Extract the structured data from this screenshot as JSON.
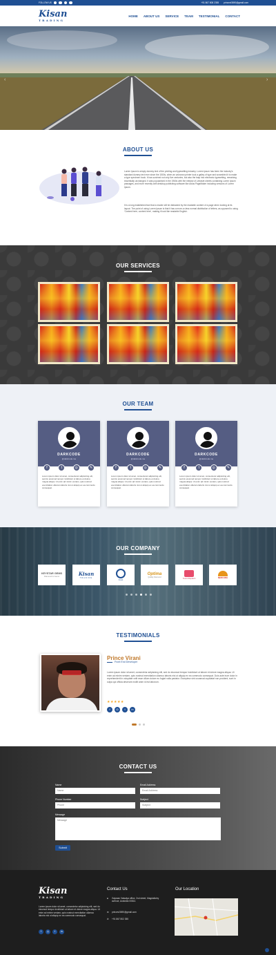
{
  "topbar": {
    "follow_label": "FOLLOW US",
    "phone": "+91 867 808 2355",
    "email": "princevi3690@gmail.com"
  },
  "brand": {
    "name": "Kisan",
    "tagline": "TRADING"
  },
  "nav": {
    "items": [
      "HOME",
      "ABOUT US",
      "SERVICE",
      "TEAM",
      "TESTIMONIAL",
      "CONTACT"
    ]
  },
  "about": {
    "title": "ABOUT US",
    "para1": "Lorem Ipsum is simply dummy text of the printing and typesetting industry. Lorem Ipsum has been the industry's standard dummy text ever since the 1500s, when an unknown printer took a galley of type and scrambled it to make a type specimen book. It has survived not only five centuries, but also the leap into electronic typesetting, remaining essentially unchanged. It was popularised in the 1960s with the release of Letraset sheets containing Lorem Ipsum passages, and more recently with desktop publishing software like Aldus PageMaker including versions of Lorem Ipsum.",
    "para2": "It is a long established fact that a reader will be distracted by the readable content of a page when looking at its layout. The point of using Lorem Ipsum is that it has a more-or-less normal distribution of letters, as opposed to using 'Content here, content here', making it look like readable English."
  },
  "services": {
    "title": "OUR SERVICES"
  },
  "team": {
    "title": "OUR TEAM",
    "members": [
      {
        "name": "DARKCODE",
        "handle": "@darkcode.me",
        "bio": "Lorem ipsum dolor sit amet, consectetur adipisicing elit, sed do eiusmod tempor incididunt ut labore et dolore magna aliqua. Ut enim ad minim veniam, quis nostrud exercitation ullamco laboris nisi ut aliquip ex ea commodo consequat."
      },
      {
        "name": "DARKCODE",
        "handle": "@darkcode.me",
        "bio": "Lorem ipsum dolor sit amet, consectetur adipisicing elit, sed do eiusmod tempor incididunt ut labore et dolore magna aliqua. Ut enim ad minim veniam, quis nostrud exercitation ullamco laboris nisi ut aliquip ex ea commodo consequat."
      },
      {
        "name": "DARKCODE",
        "handle": "@darkcode.me",
        "bio": "Lorem ipsum dolor sit amet, consectetur adipisicing elit, sed do eiusmod tempor incididunt ut labore et dolore magna aliqua. Ut enim ad minim veniam, quis nostrud exercitation ullamco laboris nisi ut aliquip ex ea commodo consequat."
      }
    ],
    "icons": [
      "f",
      "t",
      "◎",
      "✎"
    ]
  },
  "company": {
    "title": "OUR COMPANY",
    "logos": [
      {
        "name": "KEYSTAR GEMS",
        "sub": "Diamond & Gems"
      },
      {
        "name": "Kisan",
        "sub": "TRADING"
      },
      {
        "name": "Crest",
        "sub": ""
      },
      {
        "name": "Optima",
        "sub": "Quality Diamond"
      },
      {
        "name": "Tours Dispatch",
        "sub": ""
      },
      {
        "name": "NEW ERA",
        "sub": ""
      }
    ]
  },
  "testimonials": {
    "title": "TESTIMONIALS",
    "name": "Prince Virani",
    "role": "Front End Developer",
    "quote": "Lorem ipsum dolor sit amet, consectetur adipisicing elit, sed do eiusmod tempor incididunt ut labore et dolore magna aliqua. Ut enim ad minim veniam, quis nostrud exercitation ullamco laboris nisi ut aliquip ex ea commodo consequat. Duis aute irure dolor in reprehenderit in voluptate velit esse cillum dolore eu fugiat nulla pariatur. Excepteur sint occaecat cupidatat non proident, sunt in culpa qui officia deserunt mollit anim id est laborum.",
    "stars": "★★★★★"
  },
  "contact": {
    "title": "CONTACT US",
    "name_label": "Name",
    "name_placeholder": "Name",
    "email_label": "Email Address",
    "email_placeholder": "Email Address",
    "phone_label": "Phone Number",
    "phone_placeholder": "Phone",
    "subject_label": "Subject",
    "subject_placeholder": "Subject",
    "message_label": "Message",
    "message_placeholder": "Message",
    "submit_label": "Submit"
  },
  "footer": {
    "about": "Lorem ipsum dolor sit amet, consectetur adipisicing elit, sed do eiusmod tempor incididunt ut labore et dolore magna aliqua. Ut enim ad minim veniam, quis nostrud exercitation ullamco laboris nisi ut aliquip ex ea commodo consequat.",
    "contact_title": "Contact Us",
    "address": "Gajanan Vatsalya office, 2nd street, Magdalla/ey avenue, Australia 00814.",
    "email": "princevi3690@gmail.com",
    "phone": "+91 867 802 355",
    "location_title": "Our Location"
  }
}
